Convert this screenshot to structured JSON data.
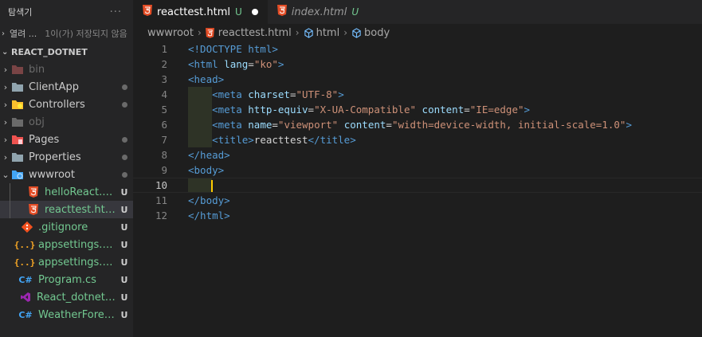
{
  "sidebar": {
    "title": "탐색기",
    "more": "···",
    "open_editors": {
      "label": "열려 ...",
      "subtitle": "1이(가) 저장되지 않음"
    },
    "project": "REACT_DOTNET",
    "items": [
      {
        "name": "bin",
        "badge": ""
      },
      {
        "name": "ClientApp",
        "badge": ""
      },
      {
        "name": "Controllers",
        "badge": ""
      },
      {
        "name": "obj",
        "badge": ""
      },
      {
        "name": "Pages",
        "badge": ""
      },
      {
        "name": "Properties",
        "badge": ""
      },
      {
        "name": "wwwroot",
        "badge": ""
      },
      {
        "name": "helloReact.h...",
        "badge": "U"
      },
      {
        "name": "reacttest.html",
        "badge": "U"
      },
      {
        "name": ".gitignore",
        "badge": "U"
      },
      {
        "name": "appsettings.D...",
        "badge": "U"
      },
      {
        "name": "appsettings.js...",
        "badge": "U"
      },
      {
        "name": "Program.cs",
        "badge": "U"
      },
      {
        "name": "React_dotnet....",
        "badge": "U"
      },
      {
        "name": "WeatherForec...",
        "badge": "U"
      }
    ]
  },
  "tabs": [
    {
      "label": "reacttest.html",
      "status": "U"
    },
    {
      "label": "index.html",
      "status": "U"
    }
  ],
  "breadcrumb": [
    "wwwroot",
    "reacttest.html",
    "html",
    "body"
  ],
  "line_numbers": [
    "1",
    "2",
    "3",
    "4",
    "5",
    "6",
    "7",
    "8",
    "9",
    "10",
    "11",
    "12"
  ],
  "code": {
    "l1": {
      "tag": "<!DOCTYPE html>"
    },
    "l2": {
      "open": "<html",
      "attr": "lang",
      "eq": "=",
      "val": "\"ko\"",
      "close": ">"
    },
    "l3": {
      "tag": "<head>"
    },
    "l4": {
      "indent": "    ",
      "open": "<meta",
      "attr": "charset",
      "eq": "=",
      "val": "\"UTF-8\"",
      "close": ">"
    },
    "l5": {
      "indent": "    ",
      "open": "<meta",
      "attr": "http-equiv",
      "eq": "=",
      "val": "\"X-UA-Compatible\"",
      "attr2": "content",
      "eq2": "=",
      "val2": "\"IE=edge\"",
      "close": ">"
    },
    "l6": {
      "indent": "    ",
      "open": "<meta",
      "attr": "name",
      "eq": "=",
      "val": "\"viewport\"",
      "attr2": "content",
      "eq2": "=",
      "val2": "\"width=device-width, initial-scale=1.0\"",
      "close": ">"
    },
    "l7": {
      "indent": "    ",
      "open": "<title>",
      "text": "reacttest",
      "close": "</title>"
    },
    "l8": {
      "tag": "</head>"
    },
    "l9": {
      "tag": "<body>"
    },
    "l10": {
      "tag": ""
    },
    "l11": {
      "tag": "</body>"
    },
    "l12": {
      "tag": "</html>"
    }
  },
  "colors": {
    "accent_untracked": "#73c991",
    "cursor": "#ffcc00",
    "html_icon": "#e44d26"
  }
}
